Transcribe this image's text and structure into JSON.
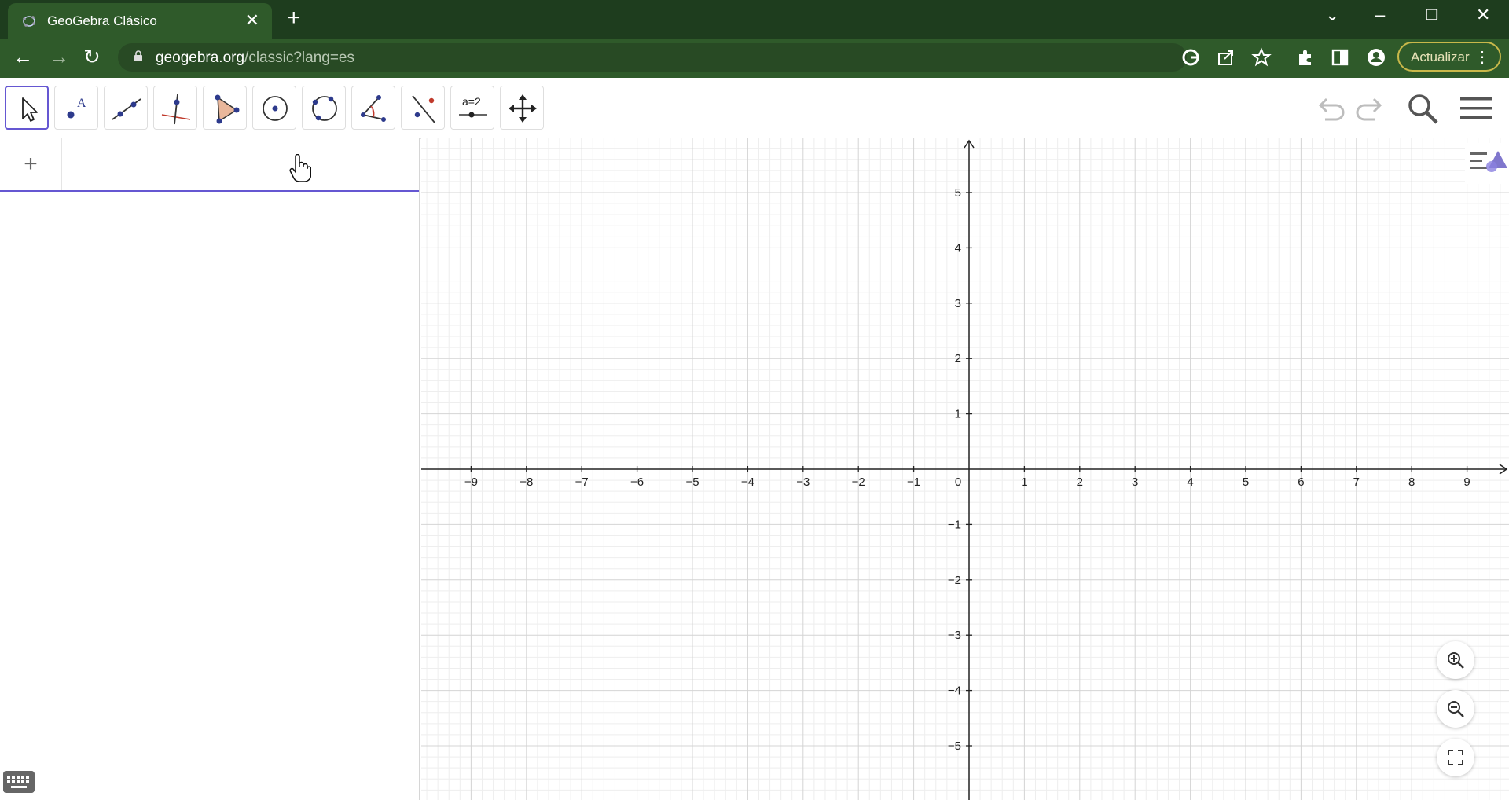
{
  "browser": {
    "tab_title": "GeoGebra Clásico",
    "url_host": "geogebra.org",
    "url_path": "/classic?lang=es",
    "update_label": "Actualizar"
  },
  "toolbar": {
    "tools": [
      "move",
      "point",
      "line",
      "perpendicular-line",
      "polygon",
      "circle-center-point",
      "circle-three-points",
      "angle",
      "reflect",
      "slider",
      "move-graphics-view"
    ],
    "slider_label": "a=2"
  },
  "graphics": {
    "x_ticks": [
      "−9",
      "−8",
      "−7",
      "−6",
      "−5",
      "−4",
      "−3",
      "−2",
      "−1",
      "0",
      "1",
      "2",
      "3",
      "4",
      "5",
      "6",
      "7",
      "8",
      "9"
    ],
    "y_ticks_pos": [
      "5",
      "4",
      "3",
      "2",
      "1"
    ],
    "y_ticks_neg": [
      "−1",
      "−2",
      "−3",
      "−4",
      "−5"
    ],
    "grid": "major and minor"
  }
}
